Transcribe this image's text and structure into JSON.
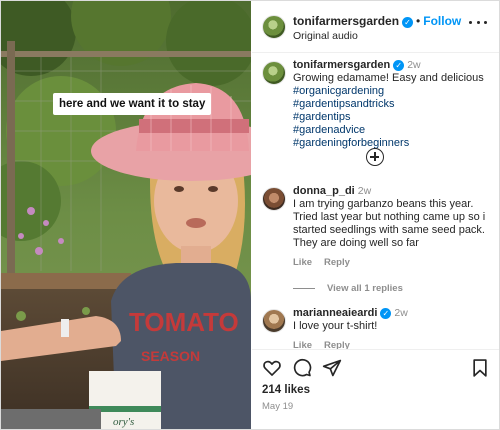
{
  "video": {
    "caption_overlay": "here and we want it to stay",
    "shirt_text": "TOMATO",
    "shirt_subtext": "SEASON",
    "packet_text": "ory's"
  },
  "header": {
    "username": "tonifarmersgarden",
    "follow_label": "Follow",
    "subtitle": "Original audio",
    "dot": "•"
  },
  "post": {
    "username": "tonifarmersgarden",
    "time": "2w",
    "text": "Growing edamame! Easy and delicious",
    "hashtags": [
      "#organicgardening",
      "#gardentipsandtricks",
      "#gardentips",
      "#gardenadvice",
      "#gardeningforbeginners"
    ]
  },
  "comments": [
    {
      "username": "donna_p_di",
      "time": "2w",
      "text": "I am trying garbanzo beans this year. Tried last year but nothing came up so i started seedlings with same seed pack. They are doing well so far",
      "like_label": "Like",
      "reply_label": "Reply",
      "view_replies": "View all 1 replies"
    },
    {
      "username": "marianneaieardi",
      "time": "2w",
      "text": "I love your t-shirt!",
      "like_label": "Like",
      "reply_label": "Reply"
    }
  ],
  "footer": {
    "likes": "214 likes",
    "date": "May 19"
  },
  "colors": {
    "accent": "#0095f6",
    "hashtag": "#00376b",
    "muted": "#8e8e8e"
  },
  "icons": [
    "more-options-icon",
    "verified-icon",
    "add-comment-icon",
    "heart-icon",
    "comment-icon",
    "share-icon",
    "bookmark-icon"
  ]
}
